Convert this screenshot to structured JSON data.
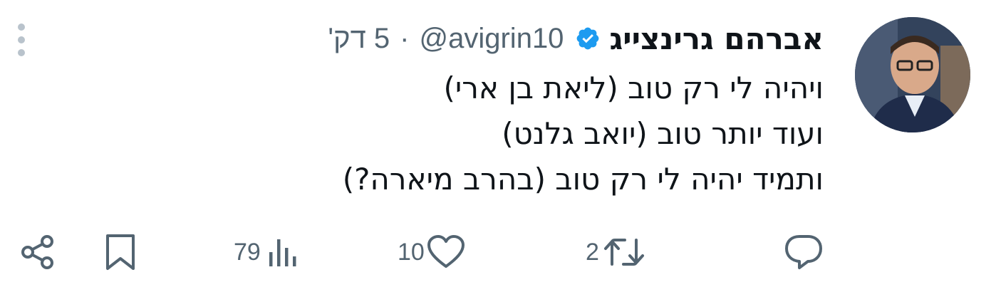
{
  "tweet": {
    "display_name": "אברהם גרינצייג",
    "handle": "@avigrin10",
    "separator": "·",
    "time": "5 דק'",
    "lines": [
      "ויהיה לי רק טוב (ליאת בן ארי)",
      "ועוד יותר טוב (יואב גלנט)",
      "ותמיד יהיה לי רק טוב (בהרב מיארה?)"
    ]
  },
  "actions": {
    "reply_count": "",
    "retweet_count": "2",
    "like_count": "10",
    "views_count": "79"
  },
  "colors": {
    "text": "#0f1419",
    "secondary": "#536471",
    "verified": "#1d9bf0",
    "more_dots": "#b9c3cc"
  },
  "icons": [
    "verified-badge-icon",
    "more-icon",
    "reply-icon",
    "retweet-icon",
    "like-icon",
    "views-icon",
    "bookmark-icon",
    "share-icon"
  ]
}
